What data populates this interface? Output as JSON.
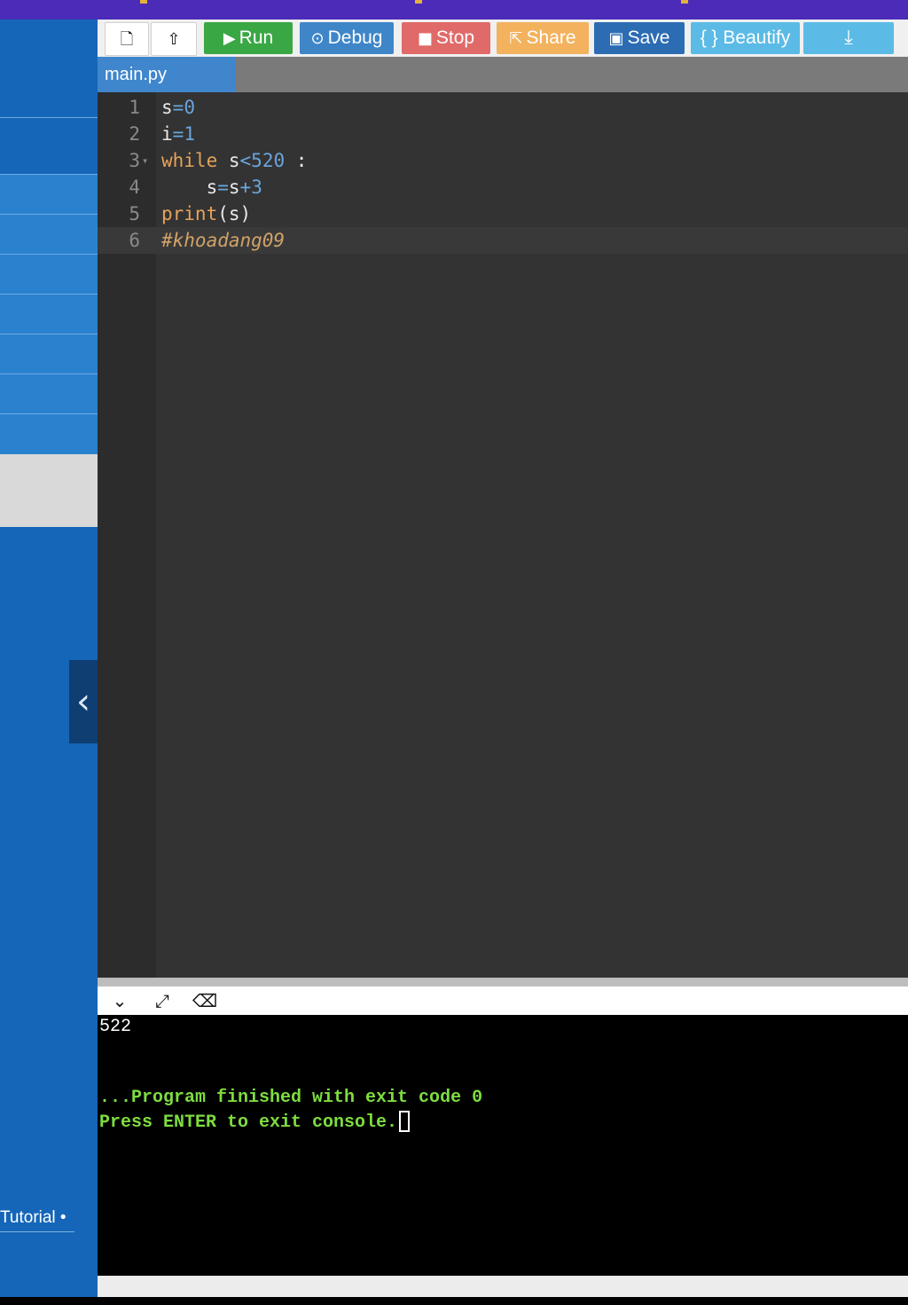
{
  "app": {
    "toolbar": {
      "new_icon": "new-file-icon",
      "upload_icon": "upload-icon",
      "run": {
        "icon": "▶",
        "label": "Run",
        "color": "#3aa745"
      },
      "debug": {
        "icon": "⊙",
        "label": "Debug",
        "color": "#3e86c8"
      },
      "stop": {
        "icon": "■",
        "label": "Stop",
        "color": "#d9534f"
      },
      "share": {
        "icon": "⇱",
        "label": "Share",
        "color": "#f0ad4e"
      },
      "save": {
        "icon": "▣",
        "label": "Save",
        "color": "#2b6cb3"
      },
      "beautify": {
        "label": "{ } Beautify",
        "color": "#4fb6e0"
      },
      "download": {
        "icon": "⤓",
        "color": "#4fb6e0"
      }
    },
    "tabs": [
      {
        "label": "main.py"
      }
    ],
    "editor": {
      "lines": [
        {
          "number": "1",
          "text": "s=0"
        },
        {
          "number": "2",
          "text": "i=1"
        },
        {
          "number": "3",
          "text": "while s<520 :"
        },
        {
          "number": "4",
          "text": "    s=s+3"
        },
        {
          "number": "5",
          "text": "print(s)"
        },
        {
          "number": "6",
          "text": "#khoadang09"
        }
      ]
    },
    "console": {
      "output": "522",
      "finished_msg": "...Program finished with exit code 0",
      "exit_msg": "Press ENTER to exit console."
    },
    "sidebar": {
      "collapse_icon": "chevron-left-icon",
      "tutorial_label": "Tutorial •"
    },
    "colors": {
      "editor_bg": "#333333",
      "console_bg": "#000000",
      "console_text": "#7ddd3f",
      "sidebar_bg": "#1566b8"
    }
  }
}
